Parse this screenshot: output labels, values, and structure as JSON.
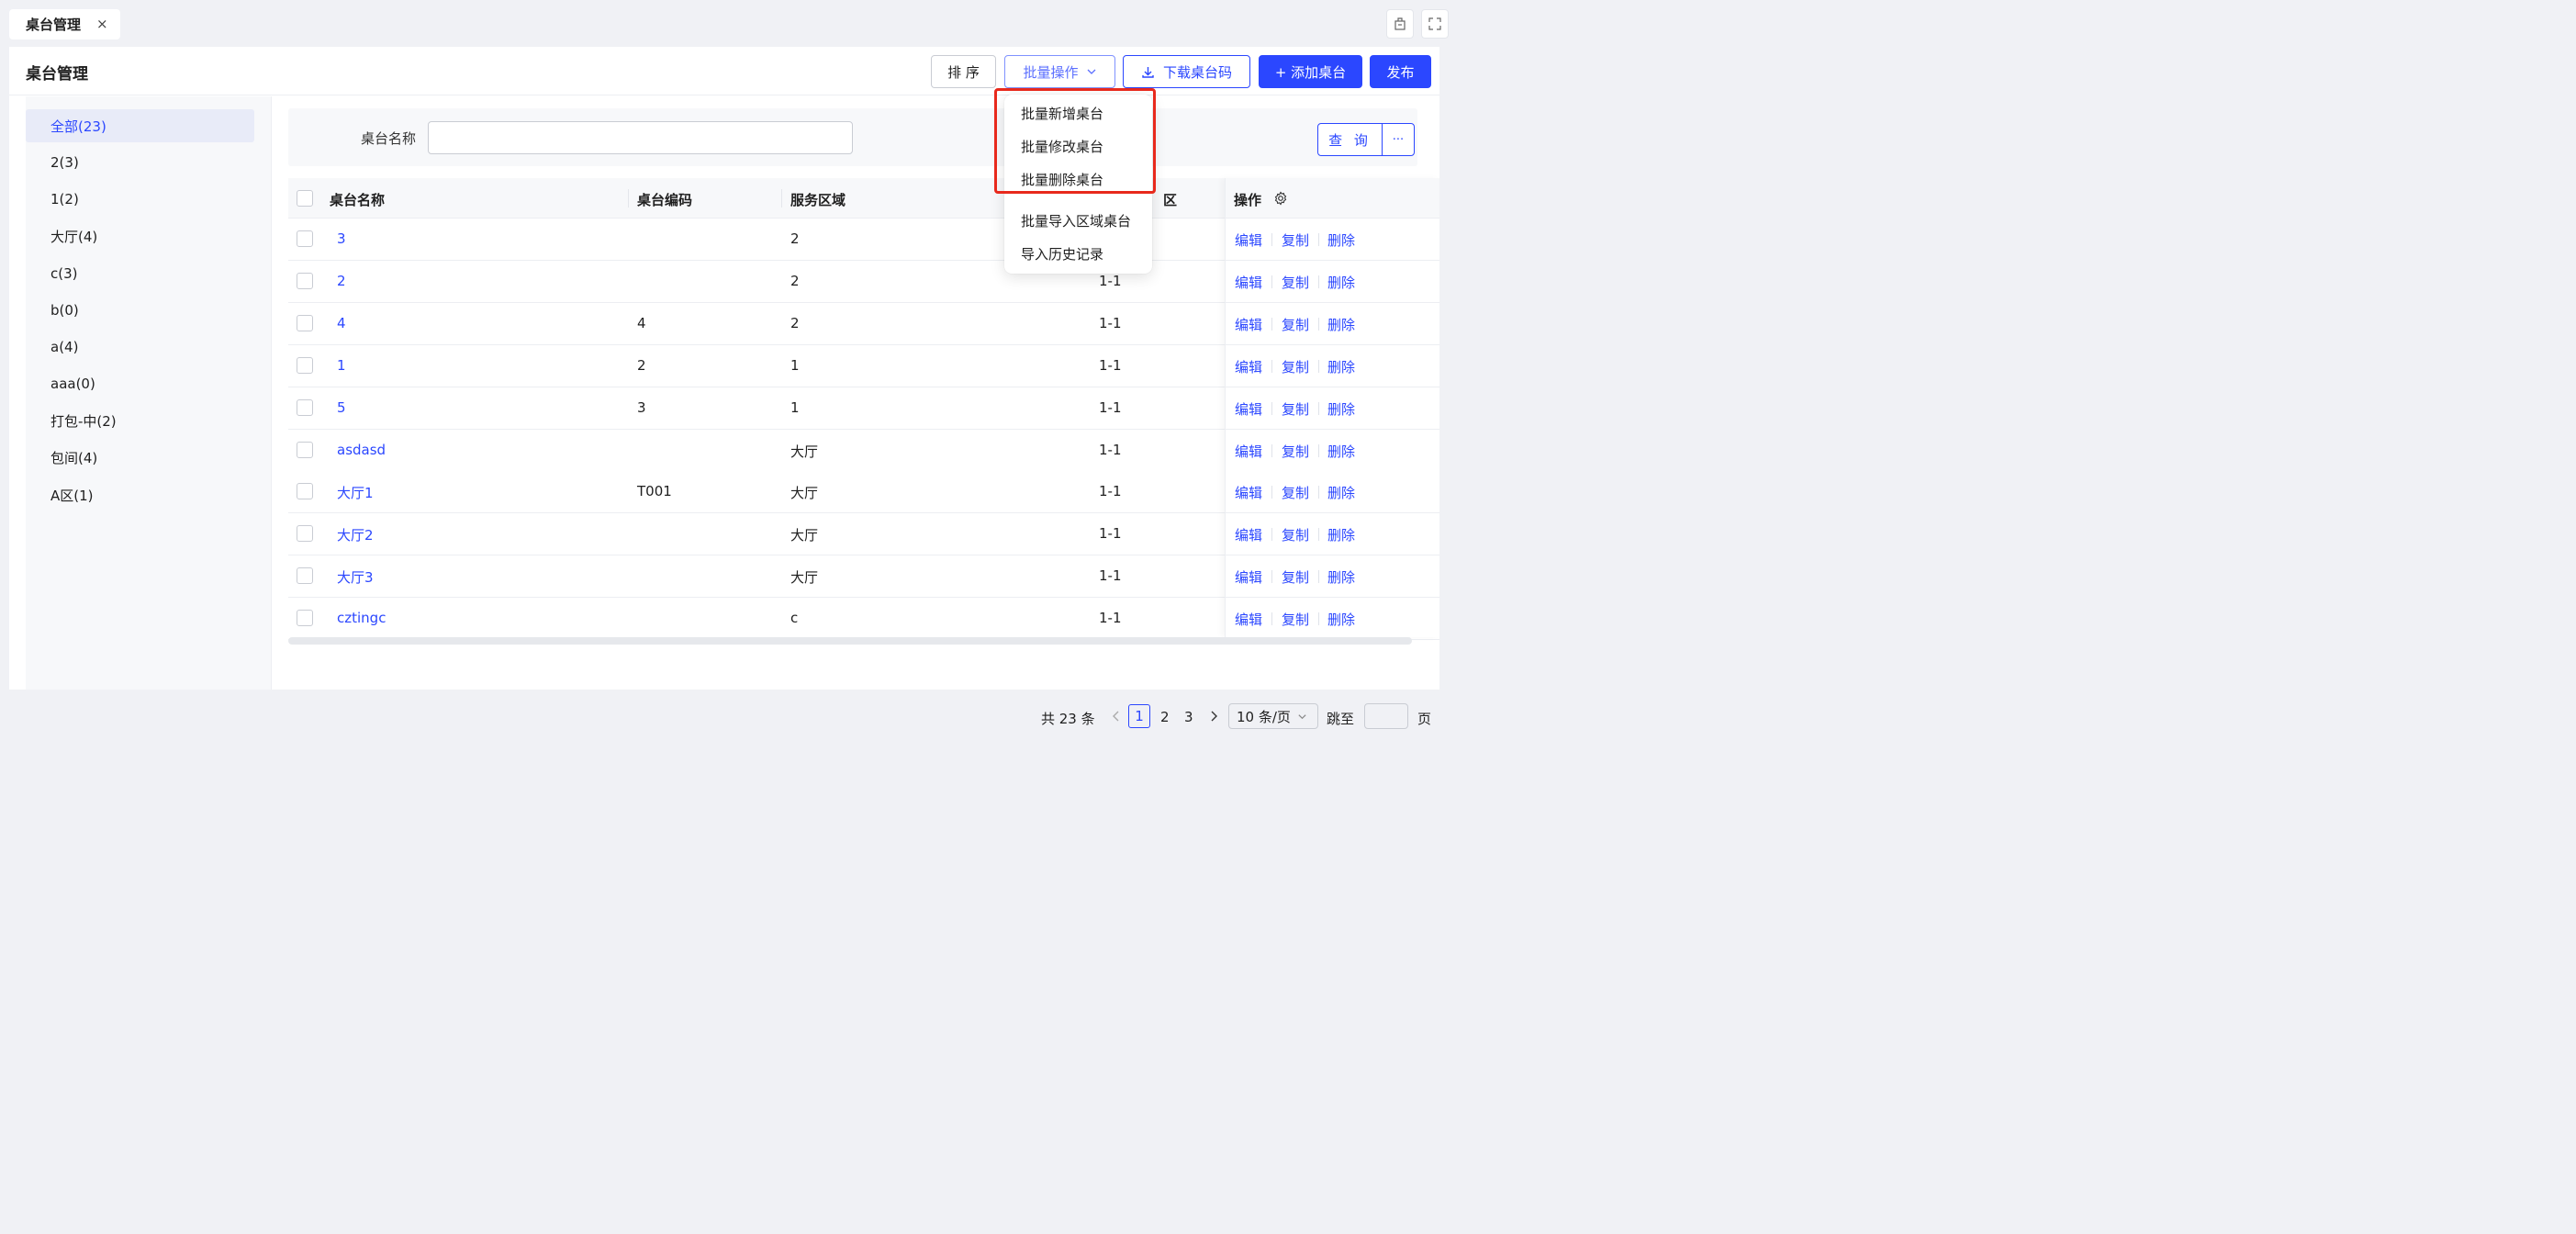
{
  "page_tabs": [
    {
      "label": "桌台管理",
      "close": "×"
    }
  ],
  "header": {
    "title": "桌台管理",
    "sort_label": "排 序",
    "batch_label": "批量操作",
    "download_label": "下载桌台码",
    "add_label": "+ 添加桌台",
    "publish_label": "发布"
  },
  "batch_menu": {
    "items": [
      "批量新增桌台",
      "批量修改桌台",
      "批量删除桌台",
      "批量导入区域桌台",
      "导入历史记录"
    ]
  },
  "sidebar": {
    "items": [
      "全部(23)",
      "2(3)",
      "1(2)",
      "大厅(4)",
      "c(3)",
      "b(0)",
      "a(4)",
      "aaa(0)",
      "打包-中(2)",
      "包间(4)",
      "A区(1)"
    ],
    "active_index": 0
  },
  "search": {
    "label": "桌台名称",
    "value": "",
    "query_label": "查 询",
    "more_label": "···"
  },
  "table": {
    "columns": [
      "桌台名称",
      "桌台编码",
      "服务区域",
      "区",
      "操作"
    ],
    "rows": [
      {
        "name": "3",
        "code": "",
        "area": "2",
        "col4": ""
      },
      {
        "name": "2",
        "code": "",
        "area": "2",
        "col4": "1-1"
      },
      {
        "name": "4",
        "code": "4",
        "area": "2",
        "col4": "1-1"
      },
      {
        "name": "1",
        "code": "2",
        "area": "1",
        "col4": "1-1"
      },
      {
        "name": "5",
        "code": "3",
        "area": "1",
        "col4": "1-1"
      },
      {
        "name": "asdasd",
        "code": "",
        "area": "大厅",
        "col4": "1-1"
      },
      {
        "name": "大厅1",
        "code": "T001",
        "area": "大厅",
        "col4": "1-1"
      },
      {
        "name": "大厅2",
        "code": "",
        "area": "大厅",
        "col4": "1-1"
      },
      {
        "name": "大厅3",
        "code": "",
        "area": "大厅",
        "col4": "1-1"
      },
      {
        "name": "cztingc",
        "code": "",
        "area": "c",
        "col4": "1-1"
      }
    ],
    "actions": [
      "编辑",
      "复制",
      "删除"
    ]
  },
  "pagination": {
    "total_label": "共 23 条",
    "pages": [
      "1",
      "2",
      "3"
    ],
    "current_page": "1",
    "page_size_label": "10 条/页",
    "jump_label": "跳至",
    "page_suffix": "页"
  },
  "colors": {
    "primary": "#2b47ff",
    "highlight": "#e8291c"
  }
}
